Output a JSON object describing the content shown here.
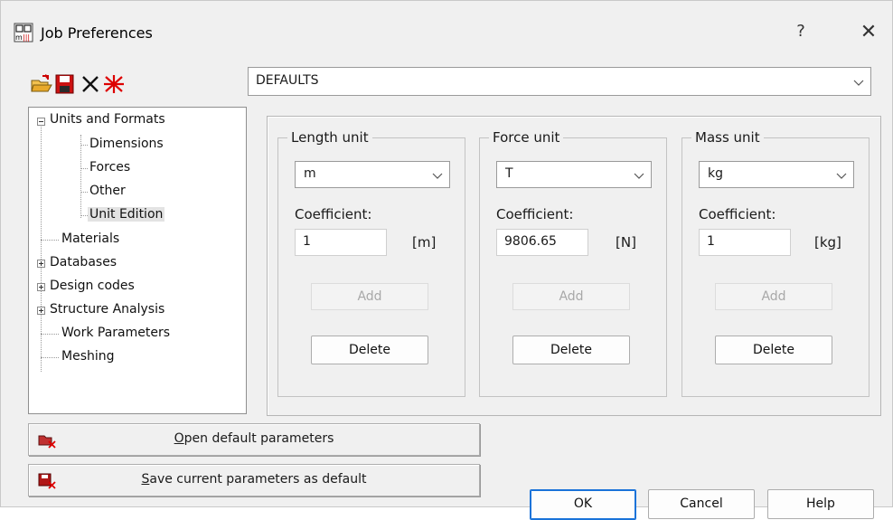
{
  "window": {
    "title": "Job Preferences",
    "help_glyph": "?",
    "close_glyph": "✕"
  },
  "toolbar": {
    "icons": [
      "open-folder-icon",
      "save-disk-icon",
      "delete-x-icon",
      "reset-star-icon"
    ]
  },
  "profile_combo": {
    "value": "DEFAULTS"
  },
  "tree": {
    "items": [
      {
        "label": "Units and Formats",
        "expander": "minus"
      },
      {
        "label": "Dimensions"
      },
      {
        "label": "Forces"
      },
      {
        "label": "Other"
      },
      {
        "label": "Unit Edition",
        "selected": true
      },
      {
        "label": "Materials"
      },
      {
        "label": "Databases",
        "expander": "plus"
      },
      {
        "label": "Design codes",
        "expander": "plus"
      },
      {
        "label": "Structure Analysis",
        "expander": "plus"
      },
      {
        "label": "Work Parameters"
      },
      {
        "label": "Meshing"
      }
    ]
  },
  "groups": [
    {
      "legend": "Length unit",
      "unit_value": "m",
      "coef_label": "Coefficient:",
      "coef_value": "1",
      "unit_suffix": "[m]",
      "add_label": "Add",
      "delete_label": "Delete"
    },
    {
      "legend": "Force unit",
      "unit_value": "T",
      "coef_label": "Coefficient:",
      "coef_value": "9806.65",
      "unit_suffix": "[N]",
      "add_label": "Add",
      "delete_label": "Delete"
    },
    {
      "legend": "Mass unit",
      "unit_value": "kg",
      "coef_label": "Coefficient:",
      "coef_value": "1",
      "unit_suffix": "[kg]",
      "add_label": "Add",
      "delete_label": "Delete"
    }
  ],
  "actions": {
    "open_default": {
      "mnemonic": "O",
      "rest": "pen default parameters"
    },
    "save_default": {
      "mnemonic": "S",
      "rest": "ave current parameters as default"
    }
  },
  "footer": {
    "ok": "OK",
    "cancel": "Cancel",
    "help": "Help"
  },
  "colors": {
    "accent": "#1a73d9",
    "dialog_bg": "#f0f0f0",
    "icon_red": "#cc0000"
  }
}
